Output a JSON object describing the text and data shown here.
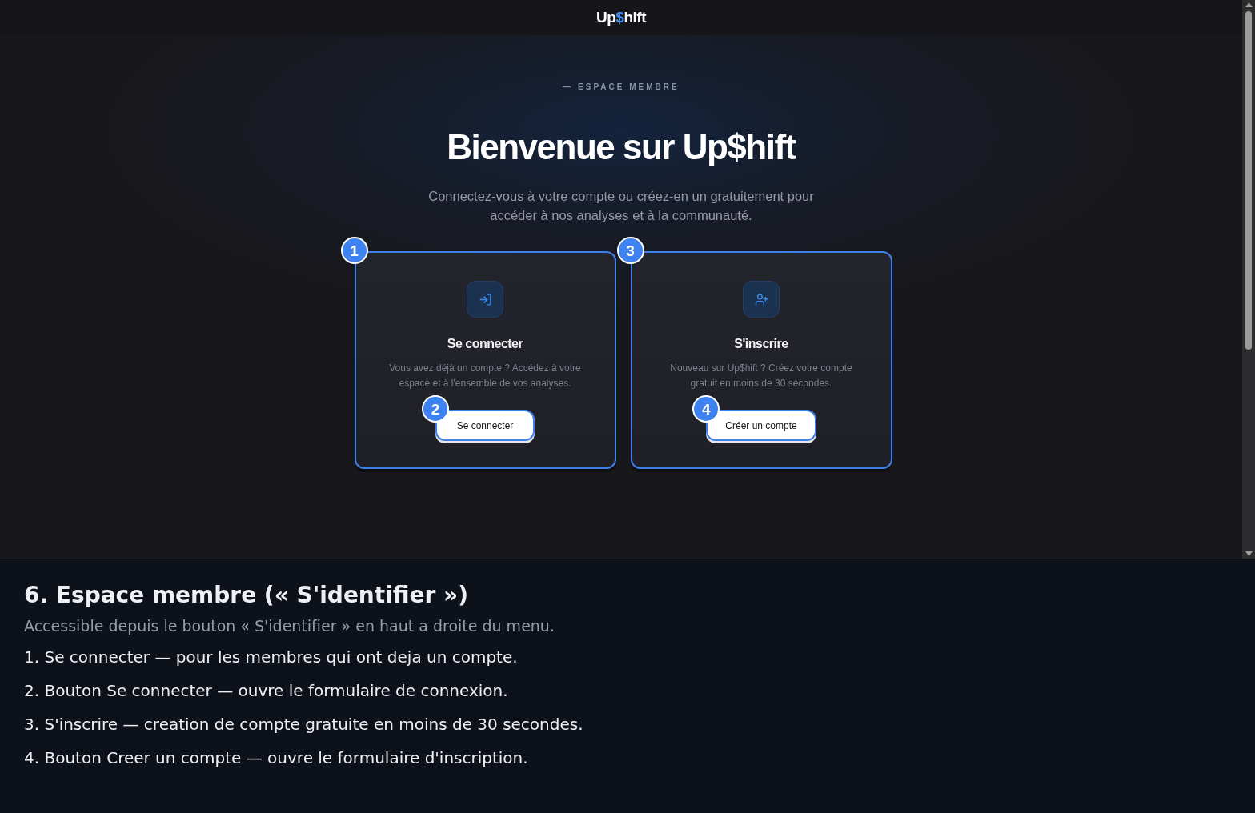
{
  "screenshot": {
    "header": {
      "logo": [
        {
          "text": "Up",
          "accent": false
        },
        {
          "text": "$",
          "accent": true
        },
        {
          "text": "hift",
          "accent": false
        }
      ]
    },
    "eyebrow": "— ESPACE MEMBRE",
    "title": "Bienvenue sur Up$hift",
    "subtitle": "Connectez-vous à votre compte ou créez-en un gratuitement pour accéder à nos analyses et à la communauté.",
    "cards": [
      {
        "kind": "login",
        "marker": "1",
        "title": "Se connecter",
        "description": "Vous avez déjà un compte ? Accédez à votre espace et à l'ensemble de vos analyses.",
        "button": {
          "label": "Se connecter",
          "marker": "2"
        }
      },
      {
        "kind": "signup",
        "marker": "3",
        "title": "S'inscrire",
        "description": "Nouveau sur Up$hift ? Créez votre compte gratuit en moins de 30 secondes.",
        "button": {
          "label": "Créer un compte",
          "marker": "4"
        }
      }
    ]
  },
  "annotation": {
    "heading": "6. Espace membre (« S'identifier »)",
    "intro": "Accessible depuis le bouton « S'identifier » en haut a droite du menu.",
    "items": [
      "1. Se connecter — pour les membres qui ont deja un compte.",
      "2. Bouton Se connecter — ouvre le formulaire de connexion.",
      "3. S'inscrire — creation de compte gratuite en moins de 30 secondes.",
      "4. Bouton Creer un compte — ouvre le formulaire d'inscription."
    ]
  }
}
